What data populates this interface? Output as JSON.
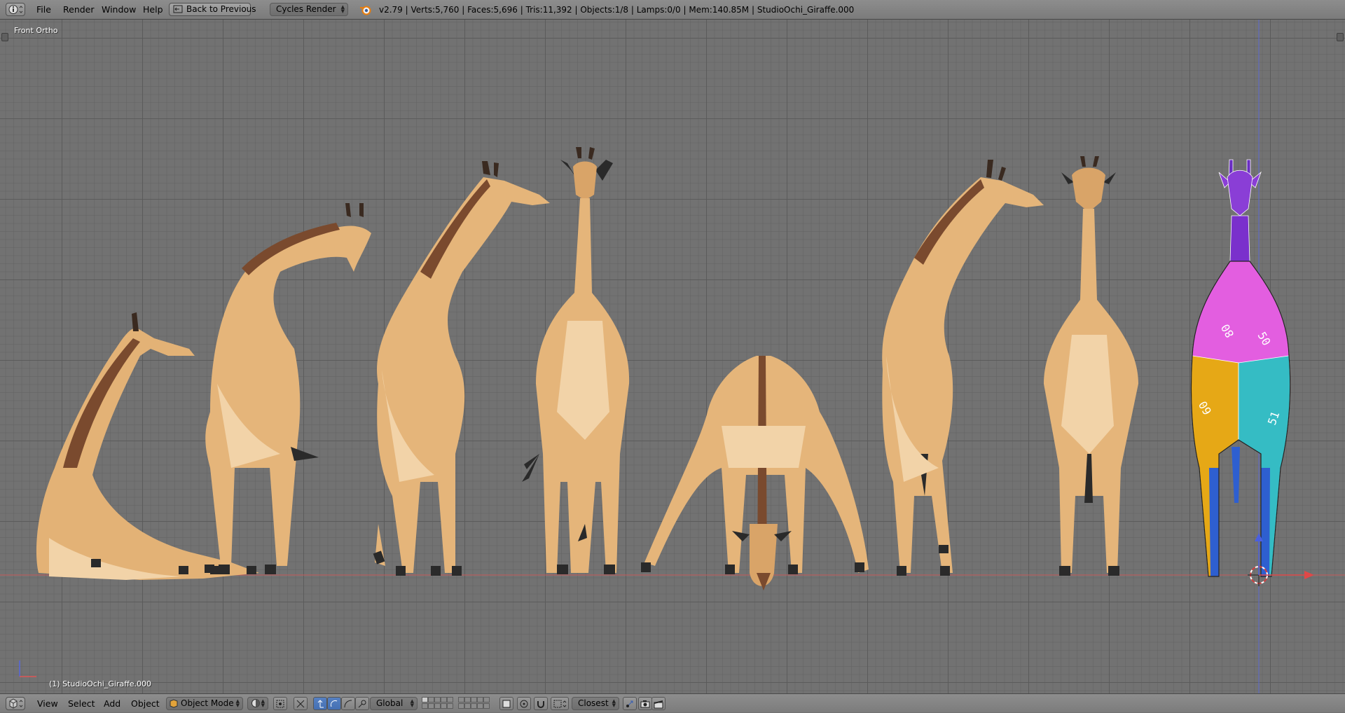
{
  "topbar": {
    "menus": [
      "File",
      "Render",
      "Window",
      "Help"
    ],
    "back_button": "Back to Previous",
    "engine": "Cycles Render",
    "stats": "v2.79 | Verts:5,760 | Faces:5,696 | Tris:11,392 | Objects:1/8 | Lamps:0/0 | Mem:140.85M | StudioOchi_Giraffe.000"
  },
  "viewport": {
    "view_name": "Front Ortho",
    "object_label": "(1) StudioOchi_Giraffe.000"
  },
  "bottombar": {
    "menus": [
      "View",
      "Select",
      "Add",
      "Object"
    ],
    "mode": "Object Mode",
    "orientation": "Global",
    "snap_target": "Closest"
  },
  "colors": {
    "giraffe_body": "#e5b57a",
    "giraffe_light": "#f2d3a8",
    "giraffe_dark": "#7a4a2e",
    "hoof": "#2a2a2a",
    "uv_purple": "#8a3ed6",
    "uv_magenta": "#e35ee0",
    "uv_yellow": "#e6a816",
    "uv_cyan": "#35bcc4",
    "uv_blue": "#2e5fd0",
    "axis_red": "#d24b4b",
    "axis_blue": "#4a5fe0",
    "selection_blue": "#4a72b8"
  }
}
